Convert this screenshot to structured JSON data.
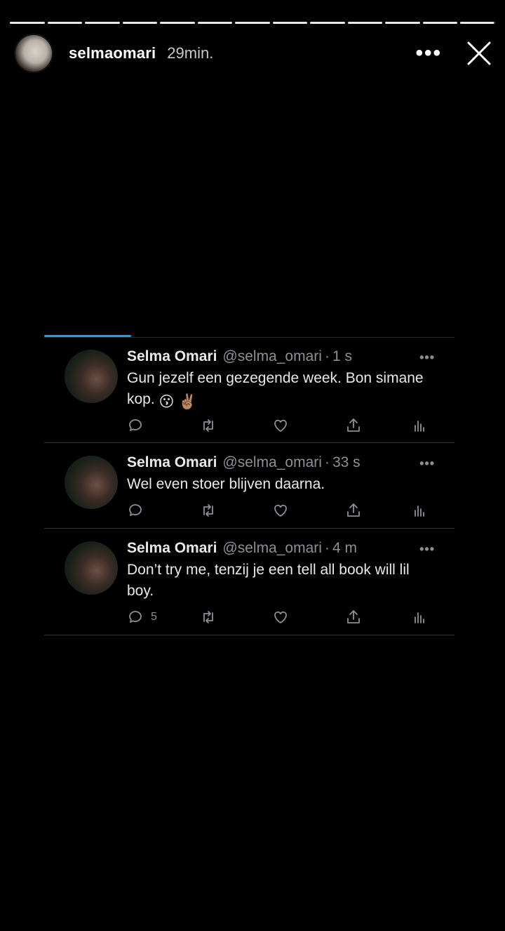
{
  "story": {
    "username": "selmaomari",
    "time": "29min.",
    "more_icon": "more-horizontal-icon",
    "close_icon": "close-icon",
    "progress_segments": [
      1,
      1,
      1,
      1,
      1,
      1,
      1,
      1,
      1,
      1,
      1,
      1,
      1
    ],
    "active_segment_fill": 1
  },
  "tweets": [
    {
      "name": "Selma Omari",
      "handle": "@selma_omari",
      "dot": "·",
      "age": "1 s",
      "text": "Gun jezelf een gezegende week. Bon simane kop. ",
      "emojis": [
        "😗",
        "✌🏽"
      ],
      "reply_count": ""
    },
    {
      "name": "Selma Omari",
      "handle": "@selma_omari",
      "dot": "·",
      "age": "33 s",
      "text": "Wel even stoer blijven daarna.",
      "emojis": [],
      "reply_count": ""
    },
    {
      "name": "Selma Omari",
      "handle": "@selma_omari",
      "dot": "·",
      "age": "4 m",
      "text": "Don’t try me, tenzij je een tell all book will lil boy.",
      "emojis": [],
      "reply_count": "5"
    }
  ],
  "colors": {
    "accent": "#1d9bf0",
    "background": "#000000",
    "muted_text": "#8b9096"
  }
}
